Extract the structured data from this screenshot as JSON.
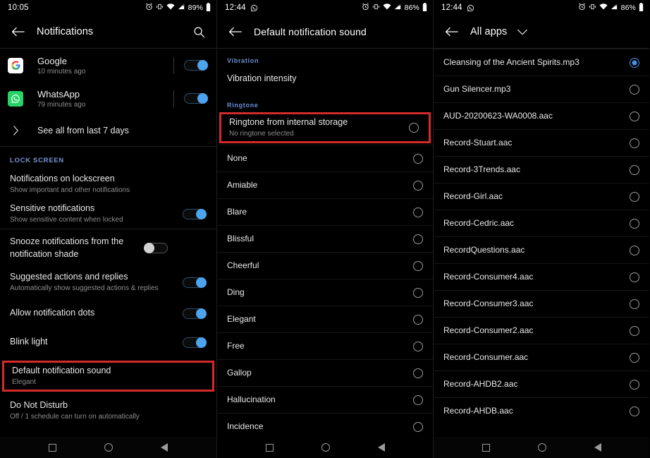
{
  "panels": [
    {
      "id": "notifications",
      "status": {
        "time": "10:05",
        "battery": "89%",
        "icons": [
          "alarm-icon",
          "vibrate-icon",
          "wifi-icon",
          "signal-icon",
          "battery-icon"
        ]
      },
      "toolbar": {
        "back": "back-arrow-icon",
        "title": "Notifications",
        "action": "search-icon"
      },
      "apps": [
        {
          "name": "Google",
          "time": "10 minutes ago",
          "icon": "google-icon",
          "toggle": "on"
        },
        {
          "name": "WhatsApp",
          "time": "79 minutes ago",
          "icon": "whatsapp-icon",
          "toggle": "on"
        }
      ],
      "see_all": "See all from last 7 days",
      "section_lock": "LOCK SCREEN",
      "settings": [
        {
          "title": "Notifications on lockscreen",
          "sub": "Show important and other notifications",
          "control": "none"
        },
        {
          "title": "Sensitive notifications",
          "sub": "Show sensitive content when locked",
          "control": "toggle",
          "toggle": "on"
        },
        {
          "title": "Snooze notifications from the notification shade",
          "sub": "",
          "control": "toggle",
          "toggle": "off"
        },
        {
          "title": "Suggested actions and replies",
          "sub": "Automatically show suggested actions & replies",
          "control": "toggle",
          "toggle": "on"
        },
        {
          "title": "Allow notification dots",
          "sub": "",
          "control": "toggle",
          "toggle": "on"
        },
        {
          "title": "Blink light",
          "sub": "",
          "control": "toggle",
          "toggle": "on"
        },
        {
          "title": "Default notification sound",
          "sub": "Elegant",
          "control": "none",
          "highlight": true
        },
        {
          "title": "Do Not Disturb",
          "sub": "Off / 1 schedule can turn on automatically",
          "control": "none"
        }
      ]
    },
    {
      "id": "default-notification-sound",
      "status": {
        "time": "12:44",
        "battery": "86%",
        "left_icon": "whatsapp-notification-icon",
        "icons": [
          "alarm-icon",
          "vibrate-icon",
          "wifi-icon",
          "signal-icon",
          "battery-icon"
        ]
      },
      "toolbar": {
        "back": "back-arrow-icon",
        "title": "Default notification sound"
      },
      "section_vibration": "Vibration",
      "vibration_item": "Vibration intensity",
      "section_ringtone": "Ringtone",
      "storage_item": {
        "title": "Ringtone from internal storage",
        "sub": "No ringtone selected",
        "selected": false,
        "highlight": true
      },
      "ringtones": [
        {
          "label": "None",
          "selected": false
        },
        {
          "label": "Amiable",
          "selected": false
        },
        {
          "label": "Blare",
          "selected": false
        },
        {
          "label": "Blissful",
          "selected": false
        },
        {
          "label": "Cheerful",
          "selected": false
        },
        {
          "label": "Ding",
          "selected": false
        },
        {
          "label": "Elegant",
          "selected": false
        },
        {
          "label": "Free",
          "selected": false
        },
        {
          "label": "Gallop",
          "selected": false
        },
        {
          "label": "Hallucination",
          "selected": false
        },
        {
          "label": "Incidence",
          "selected": false
        }
      ]
    },
    {
      "id": "all-apps-file-picker",
      "status": {
        "time": "12:44",
        "battery": "86%",
        "left_icon": "whatsapp-notification-icon",
        "icons": [
          "alarm-icon",
          "vibrate-icon",
          "wifi-icon",
          "signal-icon",
          "battery-icon"
        ]
      },
      "toolbar": {
        "back": "back-arrow-icon",
        "title": "All apps",
        "caret": "chevron-down-icon"
      },
      "files": [
        {
          "label": "Cleansing of the Ancient Spirits.mp3",
          "selected": true
        },
        {
          "label": "Gun Silencer.mp3",
          "selected": false
        },
        {
          "label": "AUD-20200623-WA0008.aac",
          "selected": false
        },
        {
          "label": "Record-Stuart.aac",
          "selected": false
        },
        {
          "label": "Record-3Trends.aac",
          "selected": false
        },
        {
          "label": "Record-Girl.aac",
          "selected": false
        },
        {
          "label": "Record-Cedric.aac",
          "selected": false
        },
        {
          "label": "RecordQuestions.aac",
          "selected": false
        },
        {
          "label": "Record-Consumer4.aac",
          "selected": false
        },
        {
          "label": "Record-Consumer3.aac",
          "selected": false
        },
        {
          "label": "Record-Consumer2.aac",
          "selected": false
        },
        {
          "label": "Record-Consumer.aac",
          "selected": false
        },
        {
          "label": "Record-AHDB2.aac",
          "selected": false
        },
        {
          "label": "Record-AHDB.aac",
          "selected": false
        }
      ]
    }
  ],
  "navbar": {
    "recents": "square-icon",
    "home": "circle-icon",
    "back": "triangle-back-icon"
  },
  "colors": {
    "accent": "#4d90e8",
    "toggle_on": "#4da3ee",
    "highlight": "#d42a2a",
    "section_label": "#7a96d6"
  }
}
